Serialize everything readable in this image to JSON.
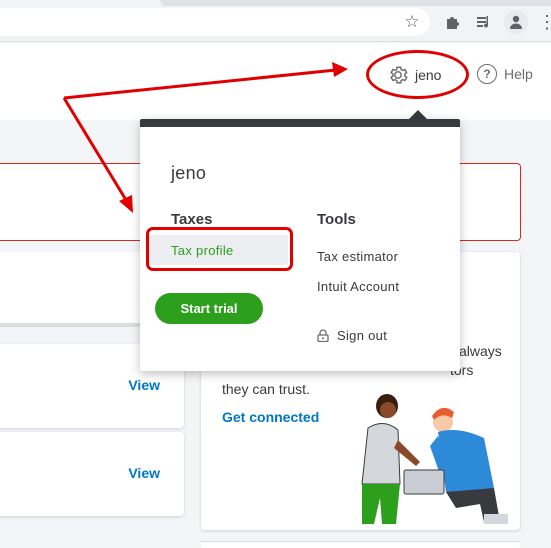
{
  "header": {
    "user_name": "jeno",
    "help_label": "Help"
  },
  "menu": {
    "user_name": "jeno",
    "taxes_heading": "Taxes",
    "tools_heading": "Tools",
    "tax_profile": "Tax profile",
    "start_trial": "Start trial",
    "tax_estimator": "Tax estimator",
    "intuit_account": "Intuit Account",
    "sign_out": "Sign out"
  },
  "cards": {
    "view_label_1": "View",
    "view_label_2": "View",
    "promo_fragment_1": "always",
    "promo_fragment_2": "tors",
    "promo_text": "they can trust.",
    "promo_link": "Get connected"
  },
  "icons": {
    "gear": "gear-icon",
    "help": "help-icon",
    "lock": "lock-icon",
    "star": "star-icon",
    "extensions": "puzzle-icon",
    "media": "media-icon",
    "profile": "profile-icon"
  },
  "colors": {
    "accent_green": "#2ca01c",
    "link_blue": "#0077c5",
    "annotation_red": "#e00000",
    "menu_dark": "#393a3d"
  }
}
